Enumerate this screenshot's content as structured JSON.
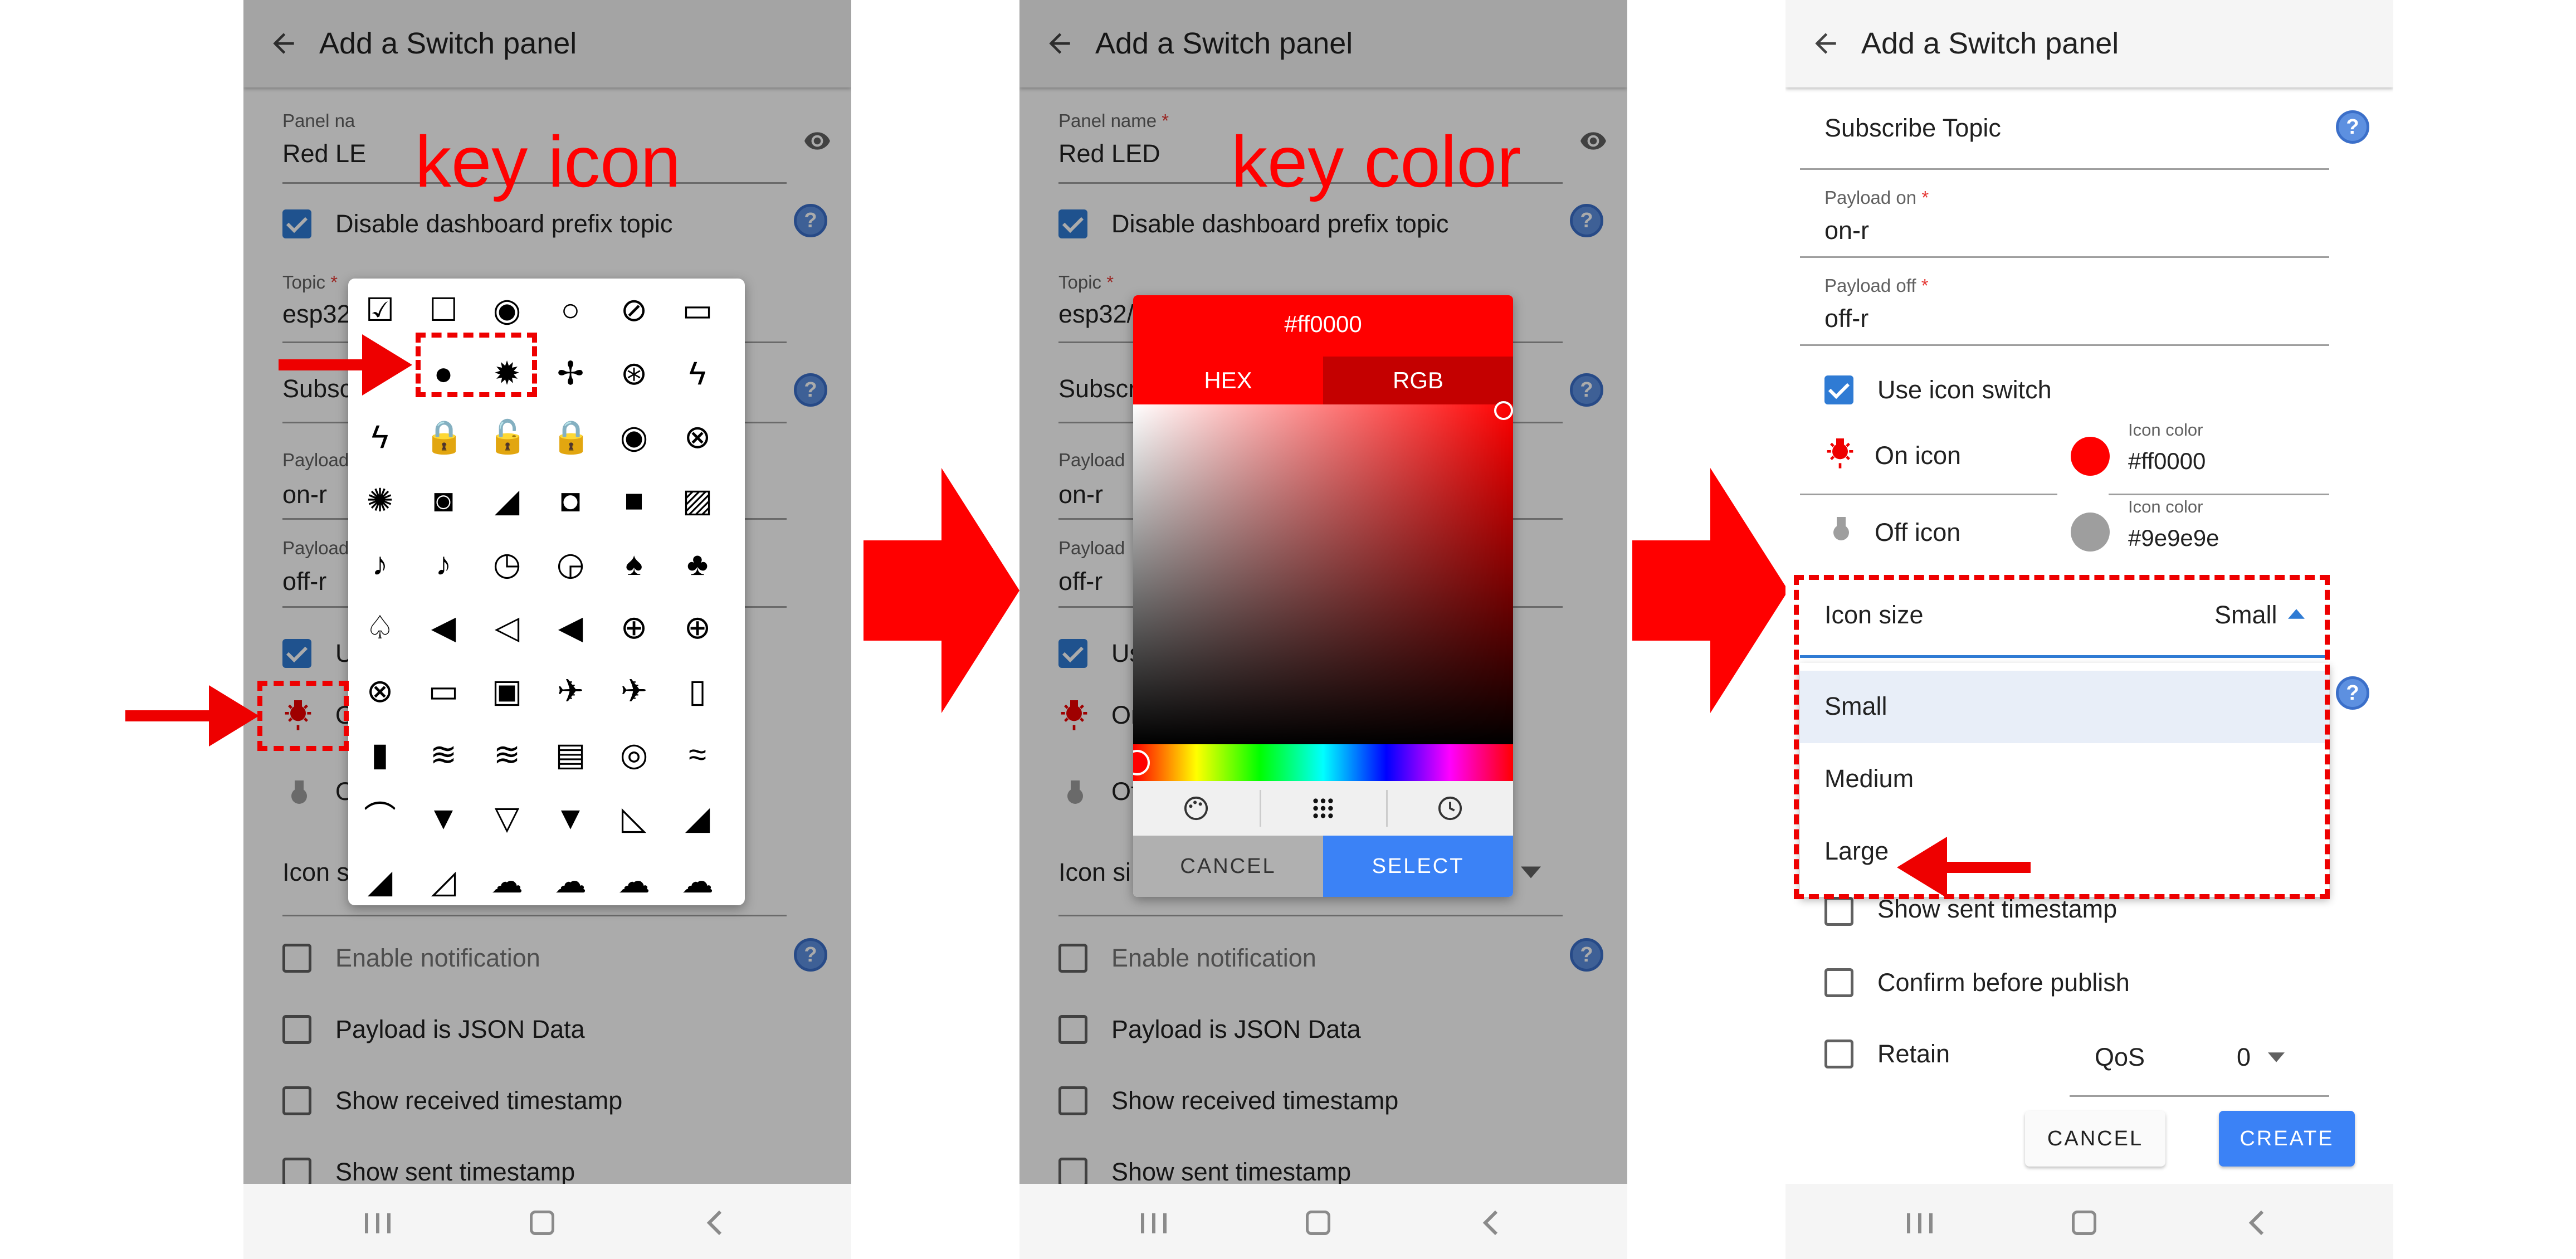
{
  "screen_common": {
    "title": "Add a Switch panel"
  },
  "panel1": {
    "annotation": "key icon",
    "panel_name_label": "Panel na",
    "panel_name_value": "Red LE",
    "disable_prefix_label": "Disable dashboard prefix topic",
    "topic_label": "Topic",
    "topic_value": "esp32",
    "subscribe_label": "Subsc",
    "payload_on_label": "Payload",
    "payload_on_value": "on-r",
    "payload_off_label": "Payload",
    "payload_off_value": "off-r",
    "use_label": "U",
    "on_label": "O",
    "off_label": "O",
    "icon_size_label": "Icon si",
    "enable_notification": "Enable notification",
    "payload_json": "Payload is JSON Data",
    "show_received": "Show received timestamp",
    "show_sent": "Show sent timestamp",
    "icons": [
      "checkbox-checked",
      "checkbox-blank",
      "radio-checked",
      "radio-blank",
      "block",
      "toggle",
      "",
      "bulb-off",
      "bulb-on",
      "fan",
      "fan-hub",
      "flash-off",
      "flash",
      "lock",
      "lock-open",
      "lock-outline",
      "eye",
      "eye-off",
      "aperture",
      "camera",
      "cctv",
      "camera-mic",
      "video",
      "video-off",
      "mic",
      "mic-off",
      "timer",
      "timer-off",
      "bell",
      "bell-ring",
      "bell-off",
      "volume-low",
      "volume-off",
      "volume-high",
      "crosshair",
      "crosshair-gps",
      "crosshair-off",
      "cast",
      "cast-connected",
      "airplane",
      "airplane-off",
      "door-open",
      "door",
      "smoking",
      "smoking-off",
      "router",
      "access-point",
      "wifi",
      "wifi-strength-1",
      "wifi-full",
      "wifi-off",
      "wifi-lock",
      "signal-off",
      "signal",
      "signal-alert",
      "signal-outline",
      "cloud",
      "cloud-check",
      "cloud-off",
      "cloud-outline"
    ]
  },
  "panel2": {
    "annotation": "key color",
    "panel_name_label": "Panel name",
    "panel_name_value": "Red LED",
    "disable_prefix_label": "Disable dashboard prefix topic",
    "topic_label": "Topic",
    "topic_value": "esp32/",
    "subscribe_label": "Subscr",
    "payload_on_label": "Payload",
    "payload_on_value": "on-r",
    "payload_off_label": "Payload",
    "payload_off_value": "off-r",
    "use_label": "Us",
    "on_label": "On",
    "off_label": "Of",
    "icon_size_label": "Icon si",
    "enable_notification": "Enable notification",
    "payload_json": "Payload is JSON Data",
    "show_received": "Show received timestamp",
    "show_sent": "Show sent timestamp",
    "color_hex": "#ff0000",
    "tab_hex": "HEX",
    "tab_rgb": "RGB",
    "cancel": "CANCEL",
    "select": "SELECT"
  },
  "panel3": {
    "subscribe_topic": "Subscribe Topic",
    "payload_on_label": "Payload on",
    "payload_on_value": "on-r",
    "payload_off_label": "Payload off",
    "payload_off_value": "off-r",
    "use_icon_switch": "Use icon switch",
    "on_icon": "On icon",
    "off_icon": "Off icon",
    "icon_color_label_1": "Icon color",
    "icon_color_value_1": "#ff0000",
    "icon_color_label_2": "Icon color",
    "icon_color_value_2": "#9e9e9e",
    "icon_size_label": "Icon size",
    "icon_size_value": "Small",
    "options": [
      "Small",
      "Medium",
      "Large"
    ],
    "show_sent": "Show sent timestamp",
    "confirm_publish": "Confirm before publish",
    "retain": "Retain",
    "qos_label": "QoS",
    "qos_value": "0",
    "cancel": "CANCEL",
    "create": "CREATE"
  },
  "colors": {
    "accent": "#ff0000",
    "off_color": "#9e9e9e",
    "primary": "#2f7bd4",
    "create_button": "#3b82f6"
  }
}
